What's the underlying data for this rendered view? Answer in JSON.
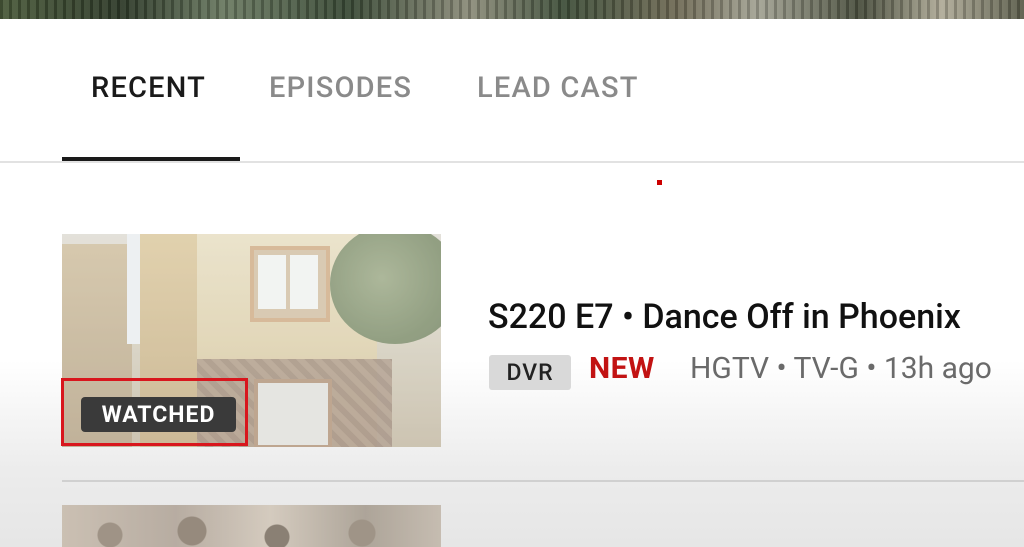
{
  "tabs": [
    {
      "label": "RECENT",
      "active": true
    },
    {
      "label": "EPISODES",
      "active": false
    },
    {
      "label": "LEAD CAST",
      "active": false
    }
  ],
  "episode": {
    "title": "S220 E7 • Dance Off in Phoenix",
    "watched_label": "WATCHED",
    "dvr_label": "DVR",
    "new_label": "NEW",
    "meta": "HGTV • TV-G • 13h ago"
  },
  "colors": {
    "highlight_box": "#d8161d",
    "new_label": "#c21313",
    "active_tab": "#1a1a1a",
    "inactive_tab": "#8a8a8a"
  }
}
